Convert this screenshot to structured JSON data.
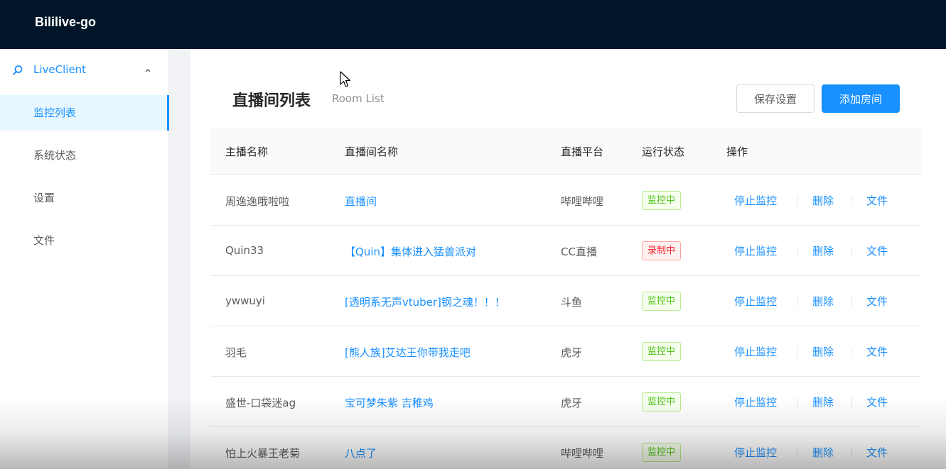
{
  "app": {
    "title": "Bililive-go"
  },
  "sidebar": {
    "submenu": {
      "label": "LiveClient",
      "icon": "search-icon",
      "expanded": true
    },
    "items": [
      {
        "label": "监控列表",
        "active": true
      },
      {
        "label": "系统状态",
        "active": false
      },
      {
        "label": "设置",
        "active": false
      },
      {
        "label": "文件",
        "active": false
      }
    ]
  },
  "page": {
    "title": "直播间列表",
    "subtitle": "Room List",
    "save_label": "保存设置",
    "add_label": "添加房间"
  },
  "table": {
    "columns": [
      "主播名称",
      "直播间名称",
      "直播平台",
      "运行状态",
      "操作"
    ],
    "actions": {
      "stop": "停止监控",
      "delete": "删除",
      "file": "文件"
    },
    "rows": [
      {
        "anchor": "周逸逸哦啦啦",
        "room": "直播间",
        "platform": "哔哩哔哩",
        "status": "监控中",
        "status_color": "#52c41a"
      },
      {
        "anchor": "Quin33",
        "room": "【Quin】集体进入猛兽派对",
        "platform": "CC直播",
        "status": "录制中",
        "status_color": "#f5222d"
      },
      {
        "anchor": "ywwuyi",
        "room": "[透明系无声vtuber]钢之魂！！！",
        "platform": "斗鱼",
        "status": "监控中",
        "status_color": "#52c41a"
      },
      {
        "anchor": "羽毛",
        "room": "[熊人族]艾达王你带我走吧",
        "platform": "虎牙",
        "status": "监控中",
        "status_color": "#52c41a"
      },
      {
        "anchor": "盛世-口袋迷ag",
        "room": "宝可梦朱紫 吉稚鸡",
        "platform": "虎牙",
        "status": "监控中",
        "status_color": "#52c41a"
      },
      {
        "anchor": "怕上火暴王老菊",
        "room": "八点了",
        "platform": "哔哩哔哩",
        "status": "监控中",
        "status_color": "#52c41a"
      }
    ]
  },
  "colors": {
    "header_bg": "#001529",
    "primary": "#1890ff",
    "monitoring": "#52c41a",
    "recording": "#f5222d"
  }
}
